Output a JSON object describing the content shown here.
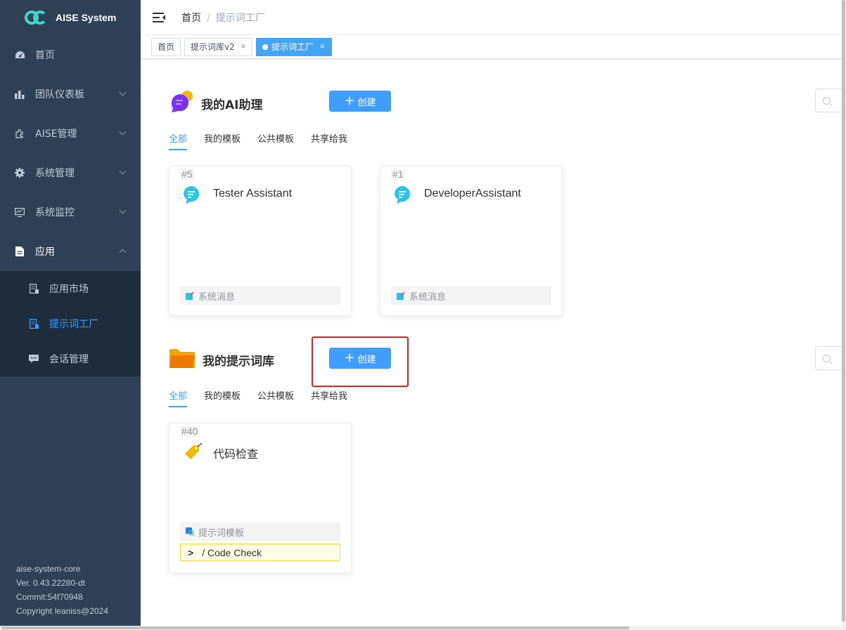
{
  "app": {
    "title": "AISE System"
  },
  "sidebar": {
    "items": [
      {
        "label": "首页",
        "icon": "dashboard-icon"
      },
      {
        "label": "团队仪表板",
        "icon": "bar-chart-icon"
      },
      {
        "label": "AISE管理",
        "icon": "puzzle-icon"
      },
      {
        "label": "系统管理",
        "icon": "gear-icon"
      },
      {
        "label": "系统监控",
        "icon": "monitor-icon"
      },
      {
        "label": "应用",
        "icon": "document-icon"
      }
    ],
    "submenu": [
      {
        "label": "应用市场",
        "icon": "store-icon"
      },
      {
        "label": "提示词工厂",
        "icon": "factory-icon"
      },
      {
        "label": "会话管理",
        "icon": "chat-icon"
      }
    ],
    "version": {
      "name": "aise-system-core",
      "ver": "Ver. 0.43.22280-dt",
      "commit": "Commit:54f70948",
      "copyright": "Copyright leaniss@2024"
    }
  },
  "navbar": {
    "breadcrumb_home": "首页",
    "breadcrumb_sep": "/",
    "breadcrumb_current": "提示词工厂"
  },
  "tags": [
    {
      "label": "首页"
    },
    {
      "label": "提示词库v2",
      "close": "×"
    },
    {
      "label": "提示词工厂",
      "close": "×"
    }
  ],
  "assistants": {
    "title": "我的AI助理",
    "create_label": "创建",
    "tabs": [
      "全部",
      "我的模板",
      "公共模板",
      "共享给我"
    ],
    "cards": [
      {
        "id": "#5",
        "name": "Tester Assistant",
        "footer": "系统消息"
      },
      {
        "id": "#1",
        "name": "DeveloperAssistant",
        "footer": "系统消息"
      }
    ]
  },
  "prompts": {
    "title": "我的提示词库",
    "create_label": "创建",
    "tabs": [
      "全部",
      "我的模板",
      "公共模板",
      "共享给我"
    ],
    "cards": [
      {
        "id": "#40",
        "name": "代码检查",
        "footer": "提示词模板",
        "cmd_prompt": ">",
        "command": "/ Code Check"
      }
    ]
  },
  "colors": {
    "sidebar_bg": "#304156",
    "accent": "#409eff",
    "highlight": "#e02020"
  }
}
